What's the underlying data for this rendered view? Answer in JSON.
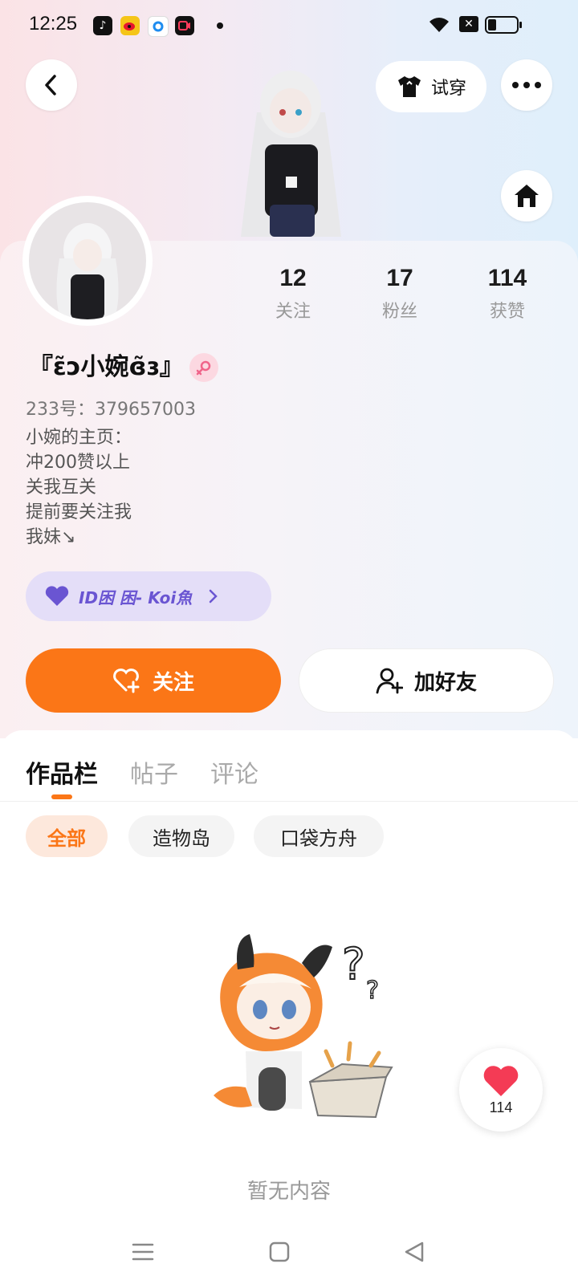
{
  "status_bar": {
    "time": "12:25",
    "apps": [
      "tiktok-icon",
      "weibo-icon",
      "qq-browser-icon",
      "video-icon"
    ],
    "battery_fraction": 0.25
  },
  "header": {
    "try_on_label": "试穿"
  },
  "profile": {
    "stats": [
      {
        "value": "12",
        "label": "关注"
      },
      {
        "value": "17",
        "label": "粉丝"
      },
      {
        "value": "114",
        "label": "获赞"
      }
    ],
    "name": "『ɛ̃ɔ小婉ɞ̃ɜ』",
    "uid_label": "233号：",
    "uid": "379657003",
    "bio_lines": [
      "小婉的主页：",
      "冲200赞以上",
      "关我互关",
      "提前要关注我",
      "我妹↘"
    ],
    "badge_text": "ID困 困- Koi魚"
  },
  "actions": {
    "follow_label": "关注",
    "add_friend_label": "加好友"
  },
  "tabs": [
    {
      "label": "作品栏",
      "active": true
    },
    {
      "label": "帖子",
      "active": false
    },
    {
      "label": "评论",
      "active": false
    }
  ],
  "chips": [
    {
      "label": "全部",
      "active": true
    },
    {
      "label": "造物岛",
      "active": false
    },
    {
      "label": "口袋方舟",
      "active": false
    }
  ],
  "empty_state": {
    "text": "暂无内容"
  },
  "like_fab": {
    "count": "114"
  },
  "colors": {
    "accent": "#fb7617",
    "badge_text": "#6a55d2",
    "gender_bg": "#fcd8e1"
  }
}
